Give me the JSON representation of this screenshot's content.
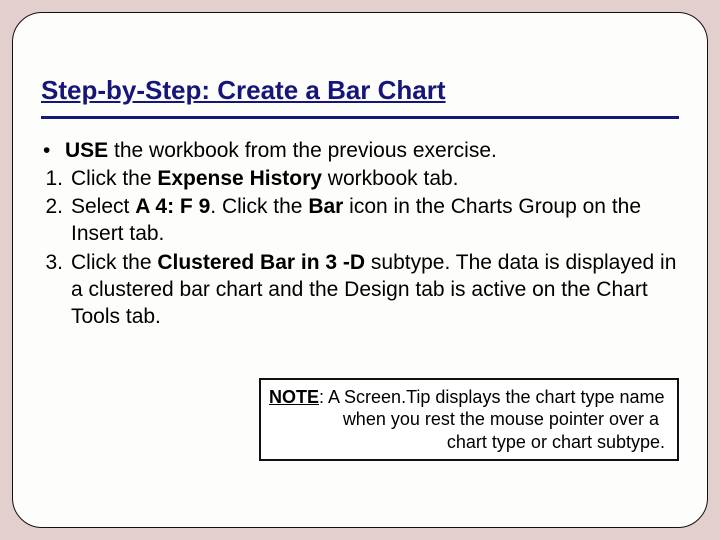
{
  "title": "Step-by-Step: Create a Bar Chart",
  "bullet": {
    "marker": "•",
    "prefix": "USE",
    "text": " the workbook from the previous exercise."
  },
  "steps": [
    {
      "n": "1.",
      "pre": "Click the ",
      "bold": "Expense History",
      "post": " workbook tab."
    },
    {
      "n": "2.",
      "segments": [
        {
          "t": "Select ",
          "b": false
        },
        {
          "t": "A 4: F 9",
          "b": true
        },
        {
          "t": ". Click the ",
          "b": false
        },
        {
          "t": "Bar",
          "b": true
        },
        {
          "t": " icon in the Charts Group on the Insert tab.",
          "b": false
        }
      ]
    },
    {
      "n": "3.",
      "segments": [
        {
          "t": "Click the ",
          "b": false
        },
        {
          "t": "Clustered Bar in 3 -D",
          "b": true
        },
        {
          "t": " subtype. The data is displayed in a clustered bar chart and the Design tab is active on the Chart Tools tab.",
          "b": false
        }
      ]
    }
  ],
  "note": {
    "label": "NOTE",
    "line1": ": A Screen.Tip displays the chart type name",
    "line2": "when you rest the mouse pointer over a",
    "line3": "chart type or chart subtype."
  }
}
